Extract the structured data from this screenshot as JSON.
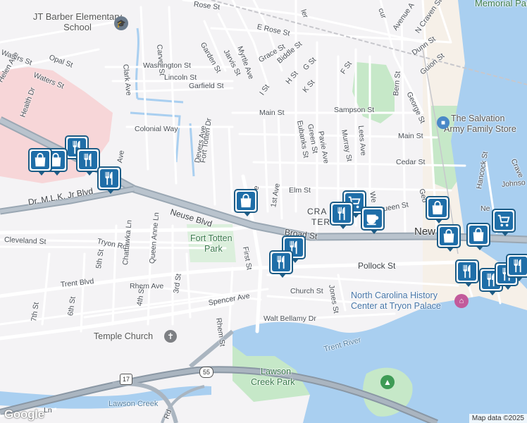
{
  "map": {
    "attribution": "Map data ©2025",
    "logo": "Google",
    "colors": {
      "land": "#f4f3f5",
      "water": "#a9cff0",
      "park": "#c6e8c8",
      "road": "#ffffff",
      "highway": "#9aa7b3",
      "hospital": "#f7d6d8",
      "commercial": "#f5ecd9",
      "pin_fill": "#1f6ea8"
    }
  },
  "streets": {
    "rose": "Rose St",
    "e_rose": "E Rose St",
    "myrtle": "Myrtle Ave",
    "jarvis": "Jarvis St",
    "garden": "Garden St",
    "carver": "Carver St",
    "waters1": "Waters St",
    "waters2": "Waters St",
    "opal": "Opal St",
    "helen": "Helen Ave",
    "clark": "Clark Ave",
    "washington": "Washington St",
    "lincoln": "Lincoln St",
    "garfield": "Garfield St",
    "grace": "Grace St",
    "biddle": "Biddle St",
    "g_st": "G St",
    "h_st": "H St",
    "k_st": "K St",
    "i_st": "I St",
    "f_st": "F St",
    "main1": "Main St",
    "main2": "Main St",
    "sampson": "Sampson St",
    "eubanks": "Eubanks St",
    "green": "Green St",
    "pavie": "Pavie Ave",
    "murray": "Murray St",
    "lees": "Lees Ave",
    "health": "Health Dr",
    "colonial": "Colonial Way",
    "devers": "Devers Ave",
    "fort_totten_dr": "Fort Totten Dr",
    "cedar": "Cedar St",
    "elm": "Elm St",
    "first_ave": "1st Ave",
    "mlk": "Dr. M.L.K. Jr Blvd",
    "neuse": "Neuse Blvd",
    "broad": "Broad St",
    "cleveland": "Cleveland St",
    "tryon": "Tryon Rd",
    "fifth": "5th St",
    "chattawka": "Chattawka Ln",
    "queen_anne": "Queen Anne Ln",
    "first_st": "First St",
    "pollock": "Pollock St",
    "trent": "Trent Blvd",
    "rhem_ave": "Rhem Ave",
    "third": "3rd St",
    "fourth": "4th St",
    "sixth": "6th St",
    "seventh": "7th St",
    "spencer": "Spencer Ave",
    "rhem_st": "Rhem St",
    "church": "Church St",
    "jones": "Jones St",
    "walt": "Walt Bellamy Dr",
    "avenue_a": "Avenue A",
    "n_craven": "N Craven St",
    "dunn": "Dunn St",
    "guion": "Guion St",
    "bern": "Bern St",
    "george": "George St",
    "hancock": "Hancock St",
    "johnson": "Johnso",
    "craven": "Crave",
    "geo": "Geo",
    "queen": "Queen St",
    "we": "We",
    "new": "New",
    "ne": "Ne",
    "ler": "ler",
    "cur": "cur",
    "ave_short": "Ave",
    "lane_short": "Ave",
    "ln": "Ln",
    "cra": "CRA",
    "terr": "TERR",
    "rd": "Rd",
    "hwy17": "17",
    "hwy55": "55"
  },
  "places": {
    "school": "JT Barber Elementary School",
    "memorial": "Memorial Park",
    "salvation1": "The Salvation",
    "salvation2": "Army Family Store",
    "fort_totten_park1": "Fort Totten",
    "fort_totten_park2": "Park",
    "history1": "North Carolina History",
    "history2": "Center at Tryon Palace",
    "temple": "Temple Church",
    "lawson_park1": "Lawson",
    "lawson_park2": "Creek Park",
    "lawson_creek": "Lawson Creek",
    "trent_river": "Trent River"
  },
  "pins": [
    {
      "icon": "restaurant-icon"
    },
    {
      "icon": "shopping-bag-icon"
    },
    {
      "icon": "restaurant-icon"
    },
    {
      "icon": "shopping-bag-icon"
    },
    {
      "icon": "restaurant-icon"
    },
    {
      "icon": "shopping-bag-icon"
    },
    {
      "icon": "shopping-cart-icon"
    },
    {
      "icon": "restaurant-icon"
    },
    {
      "icon": "coffee-icon"
    },
    {
      "icon": "restaurant-icon"
    },
    {
      "icon": "restaurant-icon"
    },
    {
      "icon": "shopping-bag-icon"
    },
    {
      "icon": "shopping-bag-icon"
    },
    {
      "icon": "shopping-bag-icon"
    },
    {
      "icon": "shopping-cart-icon"
    },
    {
      "icon": "restaurant-icon"
    },
    {
      "icon": "restaurant-icon"
    },
    {
      "icon": "restaurant-icon"
    },
    {
      "icon": "restaurant-icon"
    }
  ]
}
